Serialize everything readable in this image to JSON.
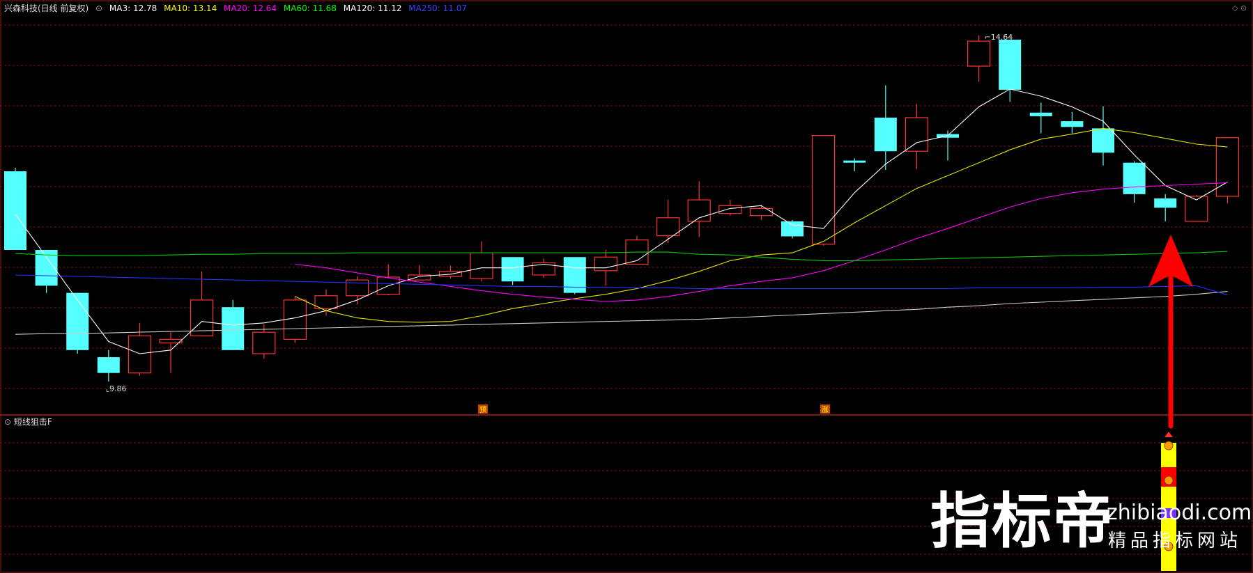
{
  "header": {
    "stock": "兴森科技(日线 前复权)",
    "ma_labels": [
      {
        "text": "MA3: 12.78",
        "color": "#ffffff"
      },
      {
        "text": "MA10: 13.14",
        "color": "#ffff00"
      },
      {
        "text": "MA20: 12.64",
        "color": "#ff00ff"
      },
      {
        "text": "MA60: 11.68",
        "color": "#00ff00"
      },
      {
        "text": "MA120: 11.12",
        "color": "#ffffff"
      },
      {
        "text": "MA250: 11.07",
        "color": "#0000ff"
      }
    ]
  },
  "indicator_panel": {
    "name": "短线狙击F"
  },
  "chart_data": {
    "type": "candlestick",
    "high_label": "14.64",
    "low_label": "9.86",
    "markers": [
      "预",
      "涨"
    ],
    "colors": {
      "up": "#ff3333",
      "down": "#55ffff"
    },
    "ylim": [
      9.5,
      15.0
    ],
    "candles": [
      [
        12.8,
        11.7,
        12.85,
        11.7
      ],
      [
        11.7,
        11.2,
        11.7,
        11.1
      ],
      [
        11.1,
        10.3,
        11.1,
        10.25
      ],
      [
        10.2,
        9.98,
        10.3,
        9.86
      ],
      [
        9.98,
        10.5,
        10.68,
        9.94
      ],
      [
        10.4,
        10.45,
        10.55,
        9.98
      ],
      [
        10.5,
        11.0,
        11.4,
        10.5
      ],
      [
        10.9,
        10.3,
        11.0,
        10.3
      ],
      [
        10.25,
        10.55,
        10.66,
        10.18
      ],
      [
        10.45,
        11.0,
        11.05,
        10.4
      ],
      [
        10.88,
        11.06,
        11.15,
        10.78
      ],
      [
        11.06,
        11.28,
        11.33,
        10.94
      ],
      [
        11.08,
        11.32,
        11.5,
        11.07
      ],
      [
        11.28,
        11.35,
        11.49,
        11.3
      ],
      [
        11.33,
        11.4,
        11.48,
        11.3
      ],
      [
        11.3,
        11.66,
        11.82,
        11.26
      ],
      [
        11.6,
        11.26,
        11.6,
        11.21
      ],
      [
        11.35,
        11.52,
        11.58,
        11.31
      ],
      [
        11.6,
        11.1,
        11.6,
        11.08
      ],
      [
        11.41,
        11.6,
        11.7,
        11.2
      ],
      [
        11.5,
        11.84,
        11.9,
        11.5
      ],
      [
        11.9,
        12.15,
        12.4,
        11.8
      ],
      [
        12.1,
        12.4,
        12.66,
        11.88
      ],
      [
        12.21,
        12.32,
        12.4,
        12.18
      ],
      [
        12.18,
        12.28,
        12.33,
        12.12
      ],
      [
        12.1,
        11.89,
        12.12,
        11.86
      ],
      [
        11.78,
        13.3,
        13.3,
        11.76
      ],
      [
        12.95,
        12.92,
        12.98,
        12.8
      ],
      [
        13.55,
        13.08,
        14.0,
        12.82
      ],
      [
        13.08,
        13.55,
        13.74,
        12.83
      ],
      [
        13.32,
        13.27,
        13.37,
        12.95
      ],
      [
        14.27,
        14.62,
        14.7,
        14.05
      ],
      [
        14.64,
        13.94,
        14.64,
        13.77
      ],
      [
        13.62,
        13.57,
        13.76,
        13.33
      ],
      [
        13.5,
        13.42,
        13.63,
        13.33
      ],
      [
        13.4,
        13.06,
        13.71,
        12.88
      ],
      [
        12.92,
        12.48,
        12.94,
        12.36
      ],
      [
        12.42,
        12.29,
        12.48,
        12.1
      ],
      [
        12.1,
        12.45,
        12.47,
        12.1
      ],
      [
        12.45,
        13.27,
        13.27,
        12.35
      ]
    ],
    "ma": {
      "MA3": [
        12.2,
        11.6,
        11.0,
        10.42,
        10.25,
        10.3,
        10.7,
        10.65,
        10.68,
        10.75,
        10.85,
        11.0,
        11.2,
        11.33,
        11.36,
        11.45,
        11.45,
        11.5,
        11.45,
        11.45,
        11.55,
        11.85,
        12.15,
        12.28,
        12.32,
        12.05,
        12.0,
        12.5,
        12.9,
        13.2,
        13.3,
        13.7,
        13.95,
        13.85,
        13.7,
        13.5,
        13.03,
        12.6,
        12.4,
        12.65
      ],
      "MA10": [
        null,
        null,
        null,
        null,
        null,
        null,
        null,
        null,
        null,
        11.05,
        10.85,
        10.75,
        10.7,
        10.69,
        10.7,
        10.78,
        10.88,
        10.95,
        11.02,
        11.08,
        11.16,
        11.27,
        11.4,
        11.55,
        11.63,
        11.66,
        11.82,
        12.08,
        12.32,
        12.56,
        12.74,
        12.92,
        13.1,
        13.25,
        13.32,
        13.4,
        13.34,
        13.26,
        13.18,
        13.14
      ],
      "MA20": [
        null,
        null,
        null,
        null,
        null,
        null,
        null,
        null,
        null,
        11.5,
        11.45,
        11.38,
        11.31,
        11.25,
        11.19,
        11.13,
        11.08,
        11.04,
        11.01,
        10.98,
        11.0,
        11.05,
        11.12,
        11.2,
        11.26,
        11.31,
        11.41,
        11.55,
        11.7,
        11.86,
        12.0,
        12.15,
        12.3,
        12.42,
        12.5,
        12.55,
        12.58,
        12.6,
        12.62,
        12.64
      ],
      "MA60": [
        11.65,
        11.63,
        11.62,
        11.62,
        11.62,
        11.63,
        11.64,
        11.64,
        11.65,
        11.65,
        11.65,
        11.66,
        11.66,
        11.66,
        11.66,
        11.66,
        11.66,
        11.66,
        11.66,
        11.66,
        11.67,
        11.67,
        11.64,
        11.63,
        11.6,
        11.57,
        11.55,
        11.55,
        11.56,
        11.57,
        11.58,
        11.59,
        11.6,
        11.61,
        11.62,
        11.63,
        11.64,
        11.65,
        11.66,
        11.68
      ],
      "MA120": [
        10.52,
        10.53,
        10.53,
        10.54,
        10.55,
        10.56,
        10.57,
        10.58,
        10.59,
        10.6,
        10.61,
        10.62,
        10.63,
        10.64,
        10.65,
        10.66,
        10.67,
        10.68,
        10.69,
        10.7,
        10.71,
        10.72,
        10.73,
        10.75,
        10.77,
        10.79,
        10.81,
        10.83,
        10.85,
        10.87,
        10.9,
        10.92,
        10.95,
        10.97,
        10.99,
        11.01,
        11.03,
        11.05,
        11.08,
        11.12
      ],
      "MA250": [
        11.35,
        11.34,
        11.33,
        11.32,
        11.31,
        11.3,
        11.29,
        11.28,
        11.27,
        11.26,
        11.25,
        11.24,
        11.23,
        11.22,
        11.21,
        11.2,
        11.19,
        11.19,
        11.18,
        11.18,
        11.17,
        11.17,
        11.16,
        11.16,
        11.16,
        11.16,
        11.16,
        11.16,
        11.16,
        11.16,
        11.16,
        11.17,
        11.17,
        11.17,
        11.17,
        11.18,
        11.18,
        11.19,
        11.2,
        11.07
      ]
    }
  },
  "watermark": {
    "brand": "指标帝",
    "url": "zhibiaodi.com",
    "tagline": "精品指标网站"
  }
}
